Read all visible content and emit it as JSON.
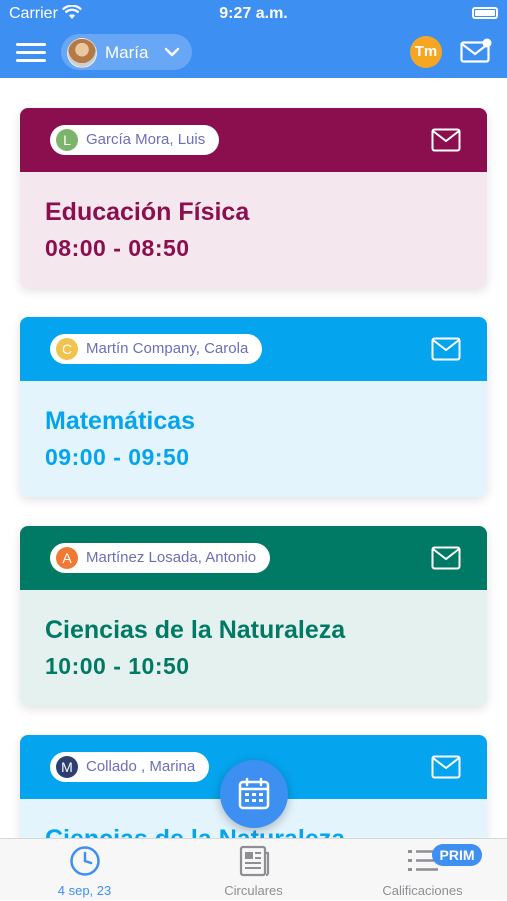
{
  "status_bar": {
    "carrier": "Carrier",
    "time": "9:27 a.m."
  },
  "header": {
    "user_name": "María",
    "notification_badge": "Tm"
  },
  "colors": {
    "primary": "#3d8ff2",
    "efisica_head": "#8b0f4e",
    "efisica_body": "#f5e7ee",
    "mates_head": "#05a4ee",
    "mates_body": "#e3f4fd",
    "ciencias_head": "#007a65",
    "ciencias_body": "#e4f1ee"
  },
  "schedule": [
    {
      "teacher": "García Mora, Luis",
      "initial": "L",
      "initial_color": "#7cb46b",
      "subject": "Educación Física",
      "hours": "08:00 - 08:50"
    },
    {
      "teacher": "Martín Company, Carola",
      "initial": "C",
      "initial_color": "#f2c24f",
      "subject": "Matemáticas",
      "hours": "09:00 - 09:50"
    },
    {
      "teacher": "Martínez Losada, Antonio",
      "initial": "A",
      "initial_color": "#f07a35",
      "subject": "Ciencias de la Naturaleza",
      "hours": "10:00 - 10:50"
    },
    {
      "teacher": "Collado , Marina",
      "initial": "M",
      "initial_color": "#2d3f6e",
      "subject": "Ciencias de la Naturaleza",
      "hours": ""
    }
  ],
  "tabs": [
    {
      "label": "4 sep, 23",
      "icon": "clock-icon",
      "active": true
    },
    {
      "label": "Circulares",
      "icon": "newspaper-icon",
      "active": false
    },
    {
      "label": "Calificaciones",
      "icon": "list-icon",
      "active": false
    }
  ],
  "tab_badge": "PRIM"
}
